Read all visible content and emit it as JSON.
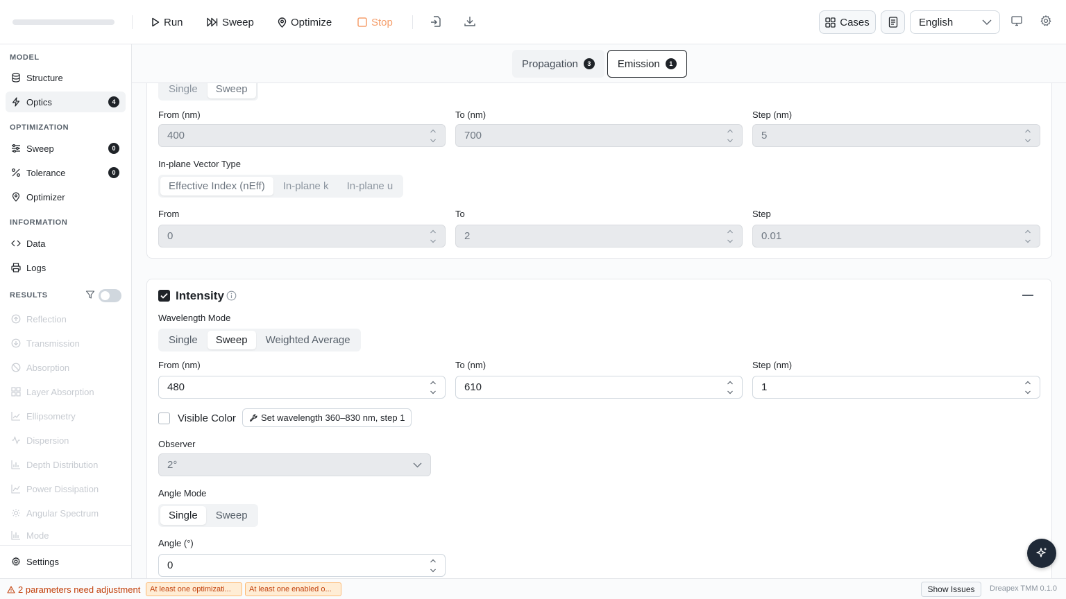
{
  "toolbar": {
    "run_label": "Run",
    "sweep_label": "Sweep",
    "optimize_label": "Optimize",
    "stop_label": "Stop",
    "cases_label": "Cases",
    "language": "English"
  },
  "sidebar": {
    "model_title": "MODEL",
    "structure": "Structure",
    "optics": "Optics",
    "optics_badge": "4",
    "optimization_title": "OPTIMIZATION",
    "sweep": "Sweep",
    "sweep_badge": "0",
    "tolerance": "Tolerance",
    "tolerance_badge": "0",
    "optimizer": "Optimizer",
    "information_title": "INFORMATION",
    "data": "Data",
    "logs": "Logs",
    "results_title": "RESULTS",
    "results_toggle_on": false,
    "results": [
      "Reflection",
      "Transmission",
      "Absorption",
      "Layer Absorption",
      "Ellipsometry",
      "Dispersion",
      "Depth Distribution",
      "Power Dissipation",
      "Angular Spectrum",
      "Mode"
    ],
    "settings": "Settings"
  },
  "tabs": [
    {
      "label": "Propagation",
      "count": "3"
    },
    {
      "label": "Emission",
      "count": "1"
    }
  ],
  "card1": {
    "mode_options": [
      "Single",
      "Sweep"
    ],
    "from_label": "From (nm)",
    "from_value": "400",
    "to_label": "To (nm)",
    "to_value": "700",
    "step_label": "Step (nm)",
    "step_value": "5",
    "vector_label": "In-plane Vector Type",
    "vector_options": [
      "Effective Index (nEff)",
      "In-plane k",
      "In-plane u"
    ],
    "from2_label": "From",
    "from2_value": "0",
    "to2_label": "To",
    "to2_value": "2",
    "step2_label": "Step",
    "step2_value": "0.01"
  },
  "intensity": {
    "title": "Intensity",
    "checked": true,
    "wl_mode_label": "Wavelength Mode",
    "wl_options": [
      "Single",
      "Sweep",
      "Weighted Average"
    ],
    "from_label": "From (nm)",
    "from_value": "480",
    "to_label": "To (nm)",
    "to_value": "610",
    "step_label": "Step (nm)",
    "step_value": "1",
    "visible_color_label": "Visible Color",
    "set_wl_button": "Set wavelength 360–830 nm, step 1",
    "observer_label": "Observer",
    "observer_value": "2°",
    "angle_mode_label": "Angle Mode",
    "angle_options": [
      "Single",
      "Sweep"
    ],
    "angle_label": "Angle (°)",
    "angle_value": "0"
  },
  "status": {
    "warning": "2 parameters need adjustment",
    "chip1": "At least one optimizati...",
    "chip2": "At least one enabled o...",
    "show_issues": "Show Issues",
    "version": "Dreapex TMM 0.1.0"
  }
}
